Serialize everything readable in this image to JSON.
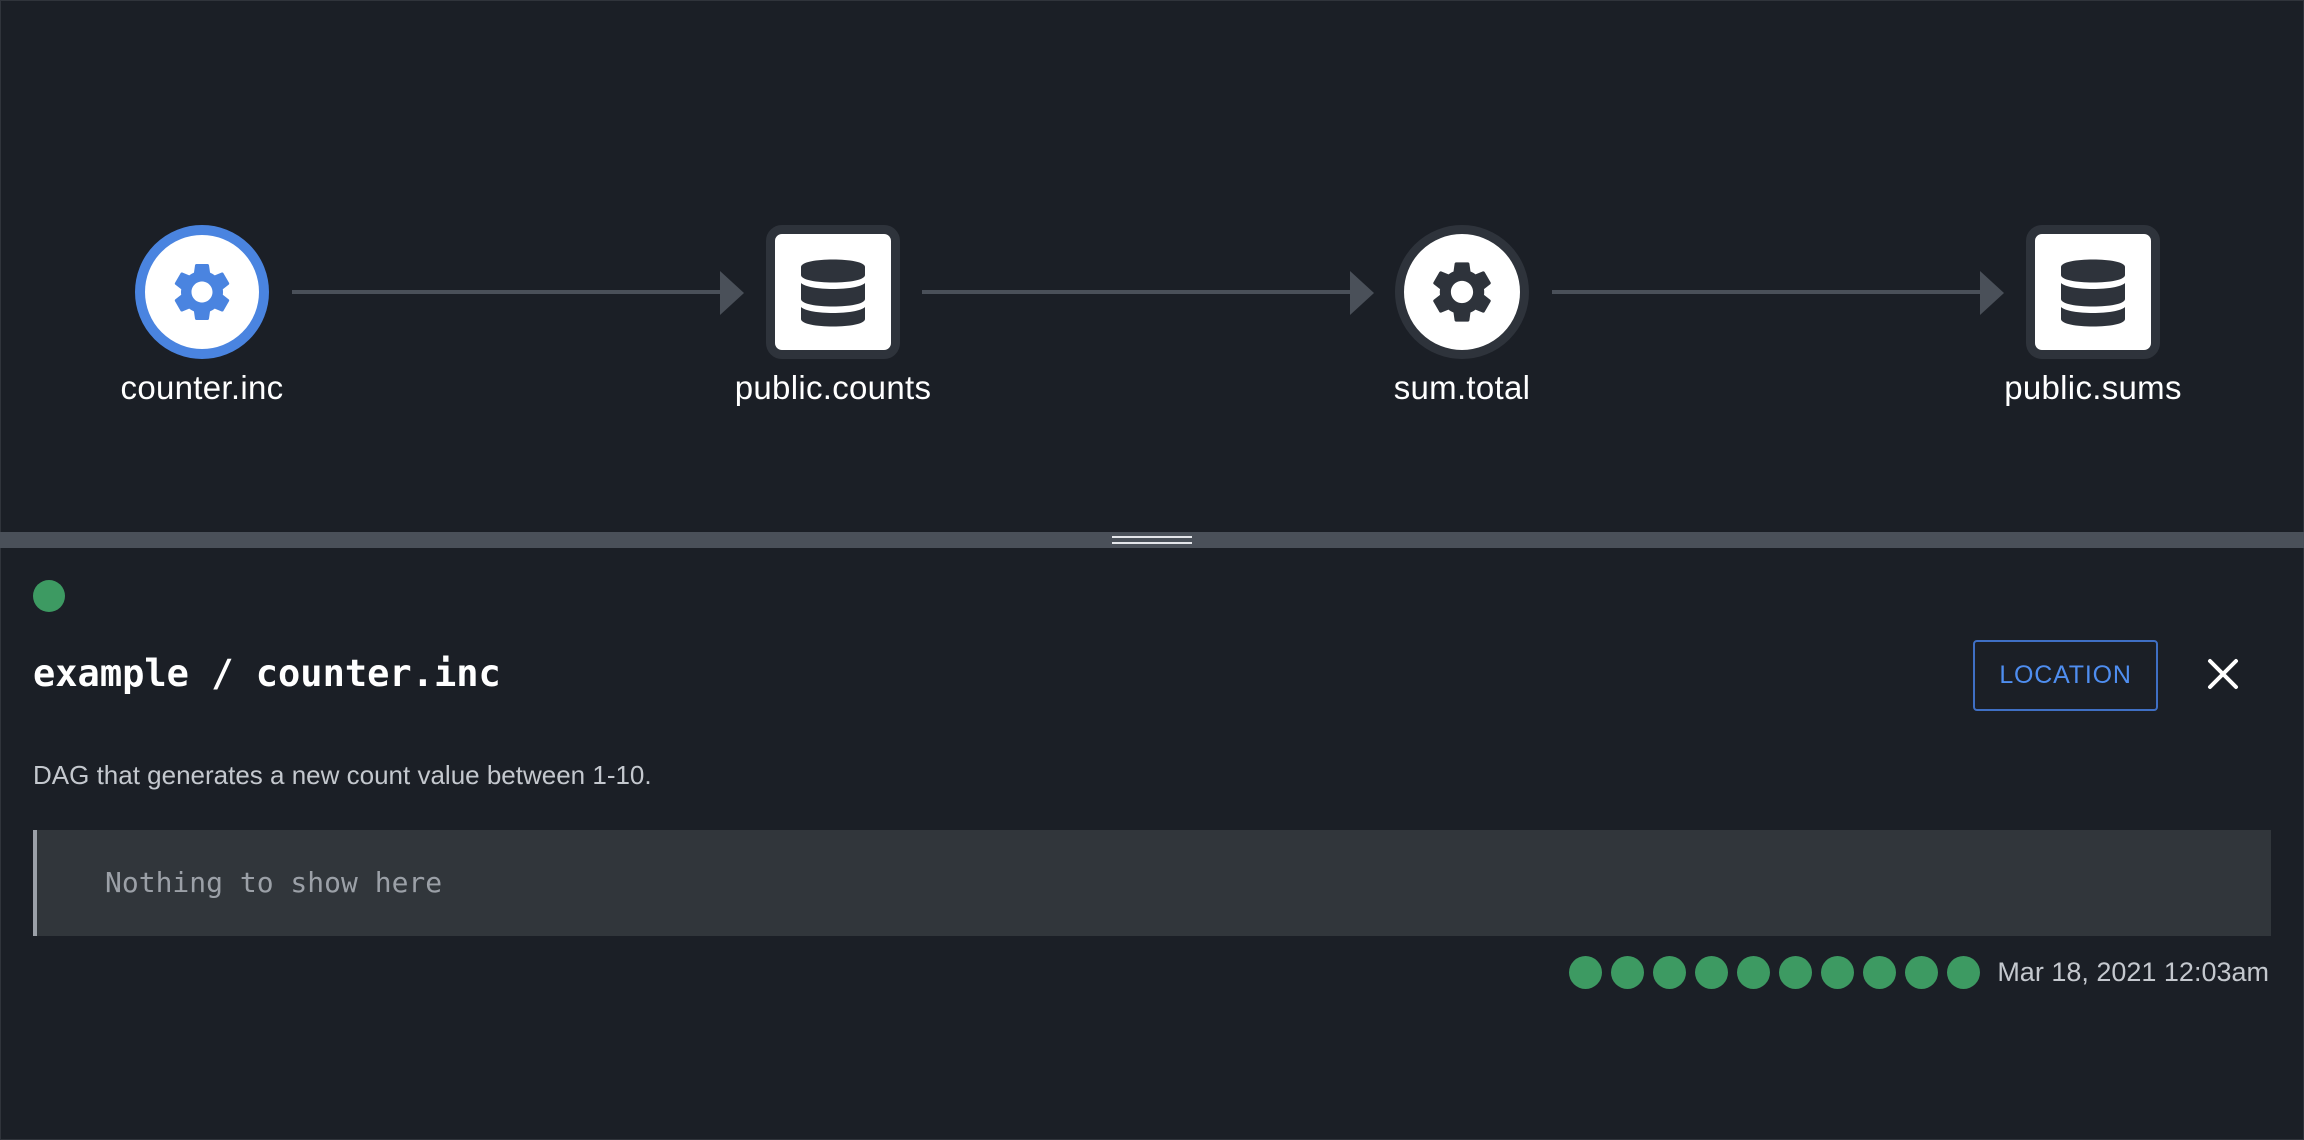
{
  "graph": {
    "nodes": [
      {
        "id": "counter.inc",
        "label": "counter.inc",
        "type": "job",
        "icon": "gear-icon",
        "selected": true
      },
      {
        "id": "public.counts",
        "label": "public.counts",
        "type": "dataset",
        "icon": "database-icon",
        "selected": false
      },
      {
        "id": "sum.total",
        "label": "sum.total",
        "type": "job",
        "icon": "gear-icon",
        "selected": false
      },
      {
        "id": "public.sums",
        "label": "public.sums",
        "type": "dataset",
        "icon": "database-icon",
        "selected": false
      }
    ],
    "edges": [
      {
        "from": "counter.inc",
        "to": "public.counts"
      },
      {
        "from": "public.counts",
        "to": "sum.total"
      },
      {
        "from": "sum.total",
        "to": "public.sums"
      }
    ]
  },
  "details": {
    "status": "success",
    "title": "example / counter.inc",
    "location_label": "LOCATION",
    "close_icon": "close-icon",
    "description": "DAG that generates a new count value between 1-10.",
    "quote_text": "Nothing to show here",
    "runs": [
      "success",
      "success",
      "success",
      "success",
      "success",
      "success",
      "success",
      "success",
      "success",
      "success"
    ],
    "last_run": "Mar 18, 2021 12:03am"
  },
  "colors": {
    "background": "#1b1f26",
    "accent": "#4a84e0",
    "success": "#3d9a62",
    "edge": "#4a5059",
    "node_border": "#2e333b",
    "node_icon": "#2e333b"
  }
}
